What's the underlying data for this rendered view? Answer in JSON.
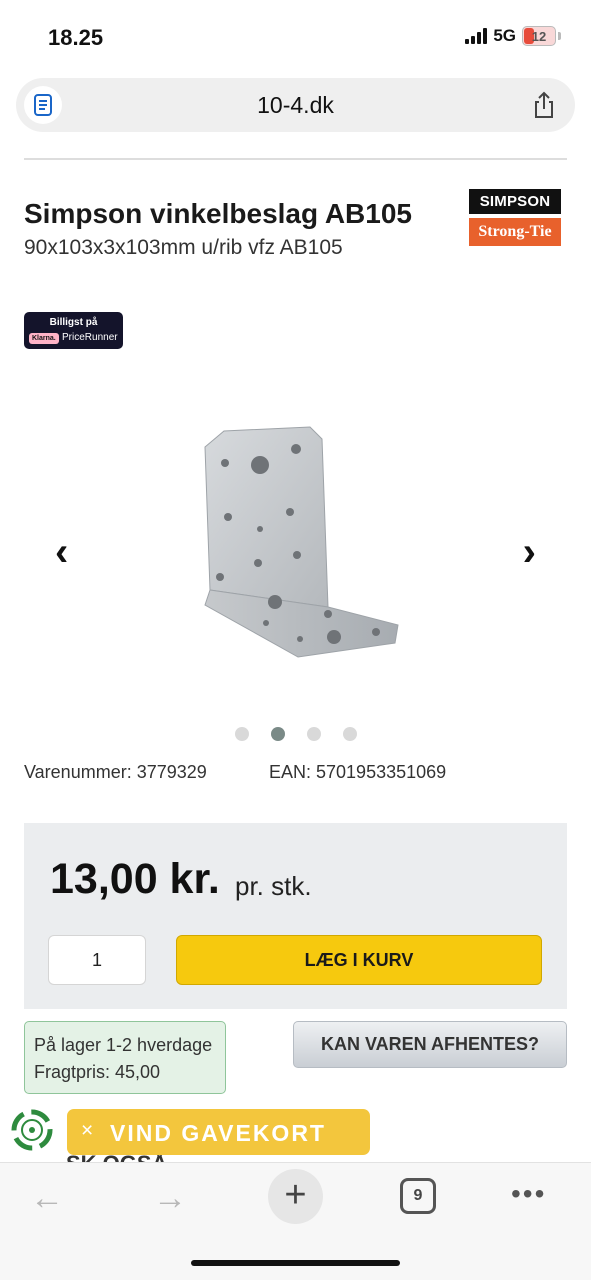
{
  "status_bar": {
    "time": "18.25",
    "network": "5G",
    "battery": "12"
  },
  "browser": {
    "url": "10-4.dk",
    "tab_count": "9"
  },
  "product": {
    "title": "Simpson vinkelbeslag AB105",
    "subtitle": "90x103x3x103mm u/rib vfz AB105",
    "brand_top": "SIMPSON",
    "brand_bottom": "Strong-Tie",
    "badge_line1": "Billigst på",
    "badge_klarna": "Klarna.",
    "badge_pricerunner": "PriceRunner",
    "sku": "Varenummer: 3779329",
    "ean": "EAN: 5701953351069",
    "carousel_total": 4,
    "carousel_active": 2
  },
  "purchase": {
    "price": "13,00 kr.",
    "unit": "pr. stk.",
    "quantity": "1",
    "add_to_cart": "LÆG I KURV",
    "stock_line1": "På lager 1-2 hverdage",
    "stock_line2": "Fragtpris: 45,00",
    "pickup": "KAN VAREN AFHENTES?"
  },
  "promo": {
    "close": "×",
    "text": "VIND GAVEKORT",
    "peek": "SK OGSÅ"
  },
  "colors": {
    "cart_button": "#f6c90e",
    "brand_orange": "#e8612c",
    "stock_bg": "#e4f2e6",
    "promo": "#f3c63d"
  }
}
